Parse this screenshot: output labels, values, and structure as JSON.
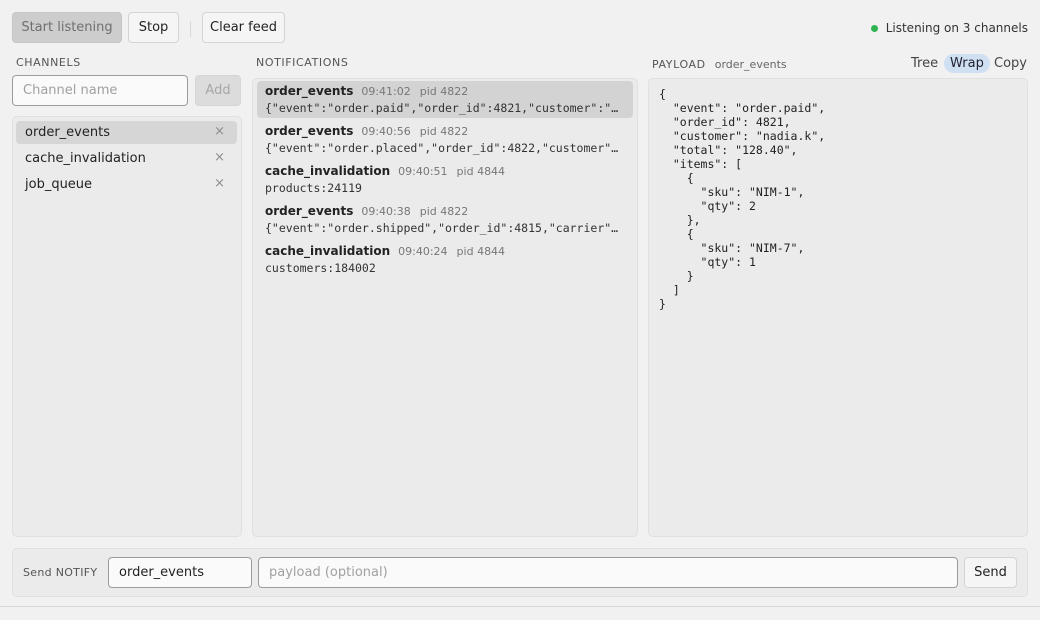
{
  "toolbar": {
    "start_label": "Start listening",
    "stop_label": "Stop",
    "clear_label": "Clear feed",
    "status_text": "Listening on 3 channels",
    "status_color": "#2fb350"
  },
  "channels": {
    "title": "CHANNELS",
    "input_placeholder": "Channel name",
    "add_label": "Add",
    "items": [
      {
        "name": "order_events",
        "selected": true
      },
      {
        "name": "cache_invalidation",
        "selected": false
      },
      {
        "name": "job_queue",
        "selected": false
      }
    ],
    "remove_glyph": "×"
  },
  "notifications": {
    "title": "NOTIFICATIONS",
    "items": [
      {
        "channel": "order_events",
        "time": "09:41:02",
        "pid": "pid 4822",
        "payload": "{\"event\":\"order.paid\",\"order_id\":4821,\"customer\":\"nadia.k\",\"total\":\"128.40\",\"items\":[{\"sku\":\"NIM-1\",\"qty\":2},{\"sku\":\"NIM-7\",\"qty\":1}]}",
        "selected": true
      },
      {
        "channel": "order_events",
        "time": "09:40:56",
        "pid": "pid 4822",
        "payload": "{\"event\":\"order.placed\",\"order_id\":4822,\"customer\":\"…",
        "selected": false
      },
      {
        "channel": "cache_invalidation",
        "time": "09:40:51",
        "pid": "pid 4844",
        "payload": "products:24119",
        "selected": false
      },
      {
        "channel": "order_events",
        "time": "09:40:38",
        "pid": "pid 4822",
        "payload": "{\"event\":\"order.shipped\",\"order_id\":4815,\"carrier\"…",
        "selected": false
      },
      {
        "channel": "cache_invalidation",
        "time": "09:40:24",
        "pid": "pid 4844",
        "payload": "customers:184002",
        "selected": false
      }
    ]
  },
  "payload": {
    "title": "PAYLOAD",
    "channel": "order_events",
    "tree_label": "Tree",
    "wrap_label": "Wrap",
    "copy_label": "Copy",
    "content": "{\n  \"event\": \"order.paid\",\n  \"order_id\": 4821,\n  \"customer\": \"nadia.k\",\n  \"total\": \"128.40\",\n  \"items\": [\n    {\n      \"sku\": \"NIM-1\",\n      \"qty\": 2\n    },\n    {\n      \"sku\": \"NIM-7\",\n      \"qty\": 1\n    }\n  ]\n}"
  },
  "send": {
    "label": "Send NOTIFY",
    "channel_value": "order_events",
    "payload_placeholder": "payload (optional)",
    "send_label": "Send"
  },
  "colors": {
    "selected_row": "#d6d6d6",
    "active_toggle": "#cfe0f2"
  }
}
